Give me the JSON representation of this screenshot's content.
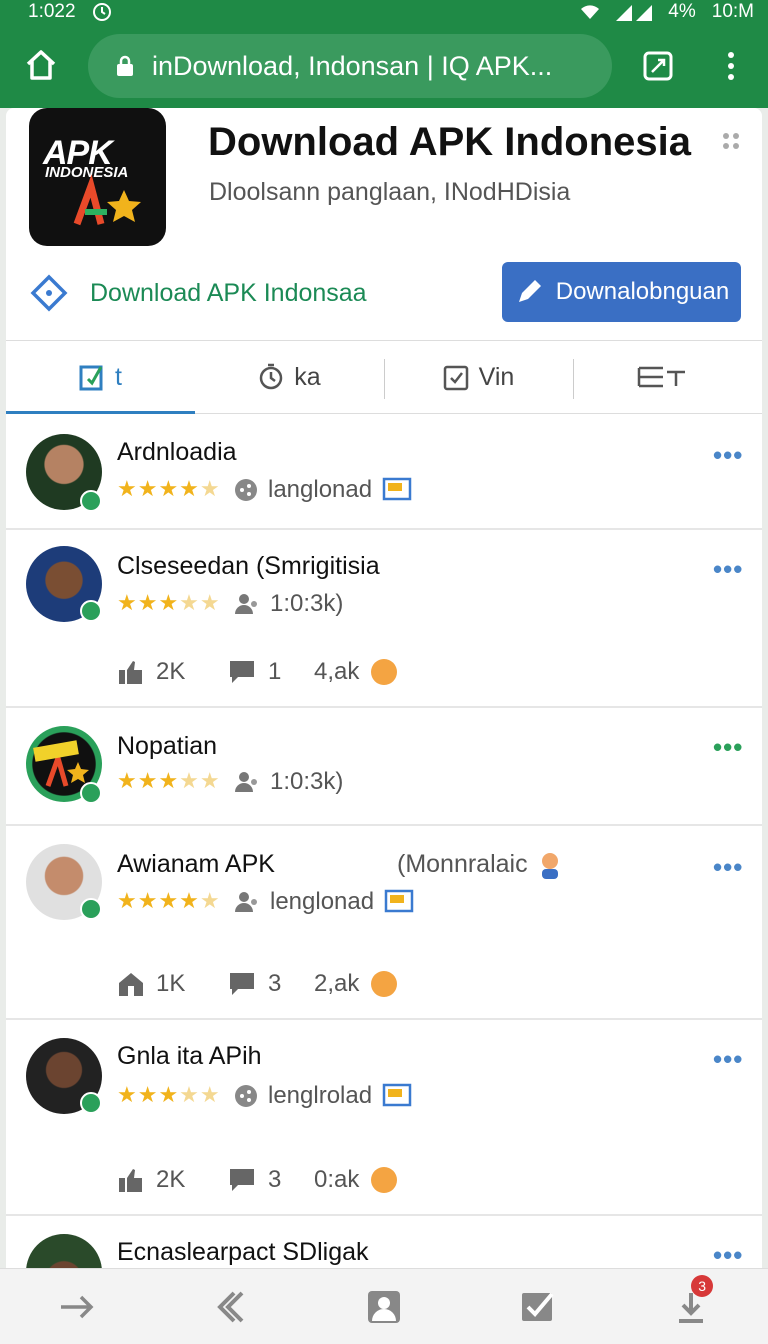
{
  "status_bar": {
    "time": "1:022",
    "battery": "4%",
    "clock": "10:M"
  },
  "browser": {
    "url": "inDownload, Indonsan | IQ APK..."
  },
  "app": {
    "logo_text_top": "APK",
    "logo_text_bottom": "INDONESIA",
    "title": "Download APK Indonesia",
    "subtitle": "Dloolsann panglaan, INodHDisia",
    "link_label": "Download APK Indonsaa",
    "download_button": "Downalobnguan"
  },
  "tabs": [
    {
      "label": "t",
      "icon": "edit-icon",
      "active": true
    },
    {
      "label": "ka",
      "icon": "timer-icon",
      "active": false
    },
    {
      "label": "Vin",
      "icon": "clipboard-icon",
      "active": false
    },
    {
      "label": "",
      "icon": "text-format-icon",
      "active": false
    }
  ],
  "feed": [
    {
      "name": "Ardnloadia",
      "extra": "",
      "rating": 4.5,
      "meta_icon": "share-icon",
      "meta": "langlonad",
      "meta_badge": "image-icon",
      "more_color": "#4a86c8",
      "counts": []
    },
    {
      "name": "Clseseedan (Smrigitisia",
      "extra": "",
      "rating": 3.5,
      "meta_icon": "people-icon",
      "meta": "1:0:3k)",
      "meta_badge": "",
      "more_color": "#4a86c8",
      "counts": [
        {
          "icon": "thumbs-up-icon",
          "value": "2K"
        },
        {
          "icon": "comment-icon",
          "value": "1"
        },
        {
          "icon": "emoji-icon",
          "value": "4,ak"
        }
      ]
    },
    {
      "name": "Nopatian",
      "extra": "",
      "rating": 3.5,
      "meta_icon": "people-icon",
      "meta": "1:0:3k)",
      "meta_badge": "",
      "more_color": "#2aa05a",
      "counts": []
    },
    {
      "name": "Awianam APK",
      "extra": "(Monnralaic",
      "rating": 4.5,
      "meta_icon": "people-icon",
      "meta": "lenglonad",
      "meta_badge": "image-icon",
      "more_color": "#4a86c8",
      "counts": [
        {
          "icon": "home-icon",
          "value": "1K"
        },
        {
          "icon": "comment-icon",
          "value": "3"
        },
        {
          "icon": "emoji-icon",
          "value": "2,ak"
        }
      ]
    },
    {
      "name": "Gnla ita APih",
      "extra": "",
      "rating": 3.5,
      "meta_icon": "share-icon",
      "meta": "lenglrolad",
      "meta_badge": "image-icon",
      "more_color": "#4a86c8",
      "counts": [
        {
          "icon": "thumbs-up-icon",
          "value": "2K"
        },
        {
          "icon": "comment-icon",
          "value": "3"
        },
        {
          "icon": "emoji-icon",
          "value": "0:ak"
        }
      ]
    },
    {
      "name": "Ecnaslearpact SDligak",
      "extra": "",
      "rating": 0,
      "meta_icon": "",
      "meta": "",
      "meta_badge": "",
      "more_color": "#4a86c8",
      "counts": []
    }
  ],
  "bottom_nav": [
    {
      "icon": "arrow-right-icon"
    },
    {
      "icon": "back-icon"
    },
    {
      "icon": "profile-icon"
    },
    {
      "icon": "check-icon"
    },
    {
      "icon": "download-icon",
      "badge": "3"
    }
  ],
  "colors": {
    "brand_green": "#1f8a46",
    "accent_blue": "#3a6fc4",
    "star": "#f1b31c"
  }
}
